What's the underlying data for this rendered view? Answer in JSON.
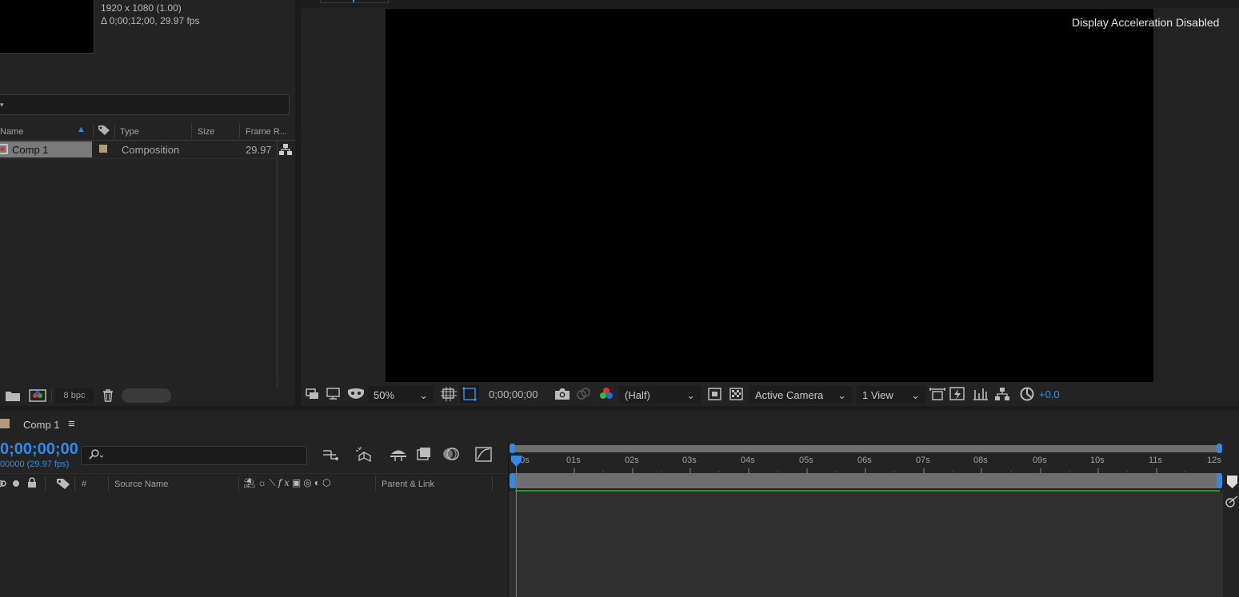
{
  "project": {
    "comp_resolution": "1920 x 1080 (1.00)",
    "comp_duration": "Δ 0;00;12;00, 29.97 fps",
    "columns": [
      "Name",
      "Type",
      "Size",
      "Frame R..."
    ],
    "items": [
      {
        "name": "Comp 1",
        "type": "Composition",
        "size": "",
        "frame_rate": "29.97",
        "label_color": "#b39b7a"
      }
    ],
    "bpc": "8 bpc"
  },
  "viewer": {
    "notice": "Display Acceleration Disabled",
    "zoom": "50%",
    "timecode": "0;00;00;00",
    "resolution": "(Half)",
    "camera": "Active Camera",
    "views": "1 View",
    "exposure": "+0.0"
  },
  "timeline": {
    "tab_label": "Comp 1",
    "current_time": "0;00;00;00",
    "frame_info": "00000 (29.97 fps)",
    "columns": {
      "number": "#",
      "source_name": "Source Name",
      "parent": "Parent & Link"
    },
    "ruler": [
      "00s",
      "01s",
      "02s",
      "03s",
      "04s",
      "05s",
      "06s",
      "07s",
      "08s",
      "09s",
      "10s",
      "11s",
      "12s"
    ]
  },
  "colors": {
    "accent": "#2d8ceb",
    "panel": "#232323",
    "canvas": "#000000",
    "work_area": "#6e6e6e",
    "green_line": "#1e9c1e"
  }
}
